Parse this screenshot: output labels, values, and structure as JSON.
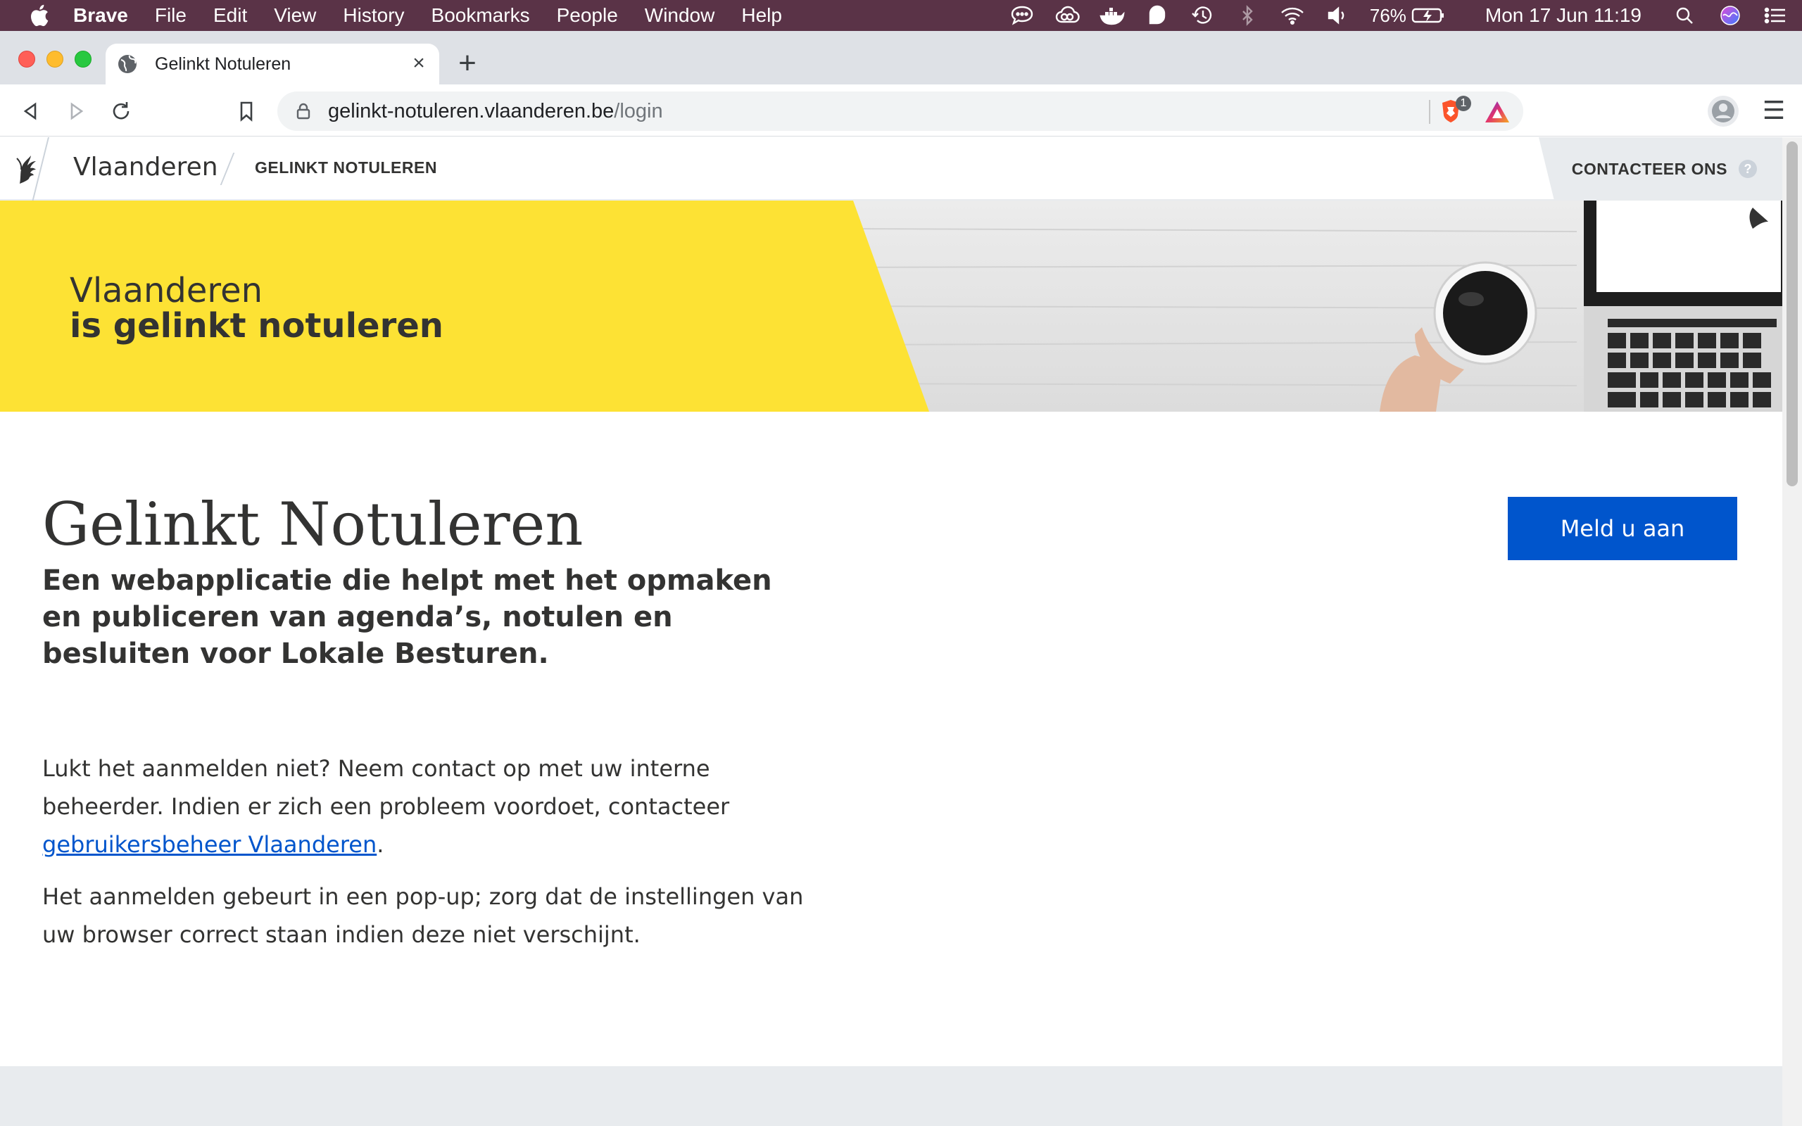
{
  "menubar": {
    "app": "Brave",
    "items": [
      "File",
      "Edit",
      "View",
      "History",
      "Bookmarks",
      "People",
      "Window",
      "Help"
    ],
    "battery": "76%",
    "datetime": "Mon 17 Jun  11:19",
    "status_icons": [
      "messages-icon",
      "creative-cloud-icon",
      "docker-icon",
      "drop-icon",
      "time-machine-icon",
      "bluetooth-icon",
      "wifi-icon",
      "volume-icon",
      "battery-icon",
      "spotlight-icon",
      "siri-icon",
      "notification-center-icon"
    ]
  },
  "browser": {
    "tab_title": "Gelinkt Notuleren",
    "url_host": "gelinkt-notuleren.vlaanderen.be",
    "url_path": "/login",
    "shields_count": "1"
  },
  "site": {
    "brand": "Vlaanderen",
    "app_name": "GELINKT NOTULEREN",
    "contact_label": "CONTACTEER ONS",
    "help_glyph": "?",
    "hero_line1": "Vlaanderen",
    "hero_line2": "is gelinkt notuleren"
  },
  "main": {
    "title": "Gelinkt Notuleren",
    "subtitle": "Een webapplicatie die helpt met het opmaken en publiceren van agenda’s, notulen en besluiten voor Lokale Besturen.",
    "info1_text": "Lukt het aanmelden niet? Neem contact op met uw interne beheerder. Indien er zich een probleem voordoet, contacteer ",
    "info1_link": "gebruikersbeheer Vlaanderen",
    "info1_end": ".",
    "info2": "Het aanmelden gebeurt in een pop-up; zorg dat de instellingen van uw browser correct staan indien deze niet verschijnt.",
    "login_button": "Meld u aan"
  },
  "colors": {
    "menubar_bg": "#5a3347",
    "hero_yellow": "#fde234",
    "primary_blue": "#0055cc",
    "text": "#333332"
  }
}
